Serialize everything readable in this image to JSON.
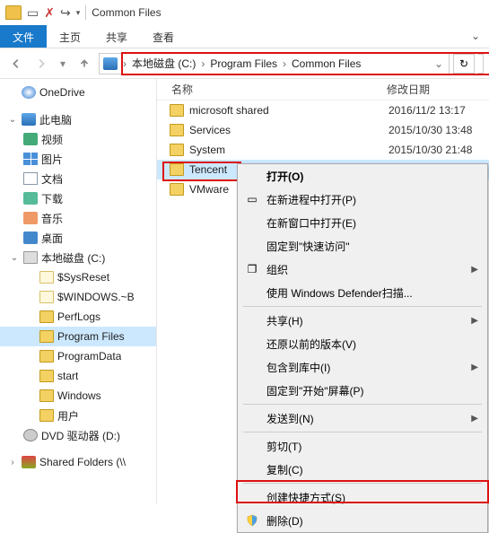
{
  "titlebar": {
    "title": "Common Files"
  },
  "ribbon": {
    "file": "文件",
    "tabs": [
      "主页",
      "共享",
      "查看"
    ]
  },
  "breadcrumbs": [
    "本地磁盘 (C:)",
    "Program Files",
    "Common Files"
  ],
  "columns": {
    "name": "名称",
    "modified": "修改日期"
  },
  "files": [
    {
      "name": "microsoft shared",
      "date": "2016/11/2 13:17"
    },
    {
      "name": "Services",
      "date": "2015/10/30 13:48"
    },
    {
      "name": "System",
      "date": "2015/10/30 21:48"
    },
    {
      "name": "Tencent",
      "date": ""
    },
    {
      "name": "VMware",
      "date": ""
    }
  ],
  "nav": {
    "onedrive": "OneDrive",
    "thispc": "此电脑",
    "videos": "视频",
    "pictures": "图片",
    "documents": "文档",
    "downloads": "下载",
    "music": "音乐",
    "desktop": "桌面",
    "drivec": "本地磁盘 (C:)",
    "sysreset": "$SysReset",
    "windowsbt": "$WINDOWS.~B",
    "perflogs": "PerfLogs",
    "programfiles": "Program Files",
    "programdata": "ProgramData",
    "start": "start",
    "windows": "Windows",
    "users": "用户",
    "dvd": "DVD 驱动器 (D:)",
    "shared": "Shared Folders (\\\\"
  },
  "ctx": {
    "open": "打开(O)",
    "newproc": "在新进程中打开(P)",
    "newwin": "在新窗口中打开(E)",
    "pinquick": "固定到\"快速访问\"",
    "org": "组织",
    "defender": "使用 Windows Defender扫描...",
    "share": "共享(H)",
    "restore": "还原以前的版本(V)",
    "include": "包含到库中(I)",
    "pinstart": "固定到\"开始\"屏幕(P)",
    "sendto": "发送到(N)",
    "cut": "剪切(T)",
    "copy": "复制(C)",
    "shortcut": "创建快捷方式(S)",
    "delete": "删除(D)"
  }
}
